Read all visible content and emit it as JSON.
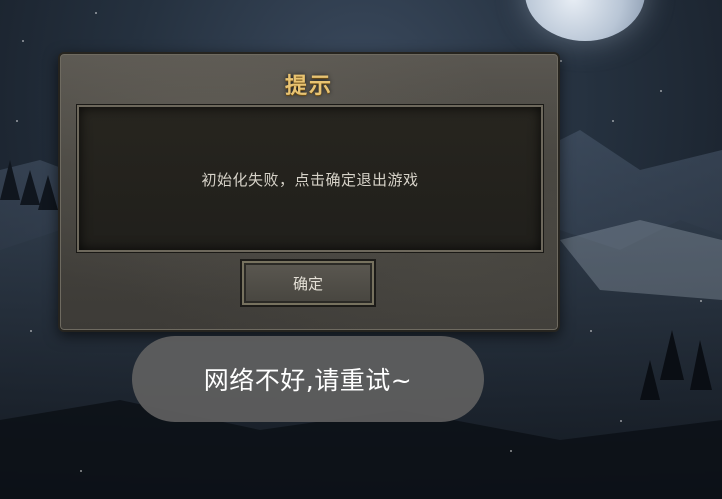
{
  "dialog": {
    "title": "提示",
    "message": "初始化失败，点击确定退出游戏",
    "confirm_label": "确定"
  },
  "toast": {
    "message": "网络不好,请重试~"
  },
  "colors": {
    "title_gold": "#e8c372",
    "panel_bg": "#27251f",
    "toast_bg": "#5f5f5f"
  }
}
